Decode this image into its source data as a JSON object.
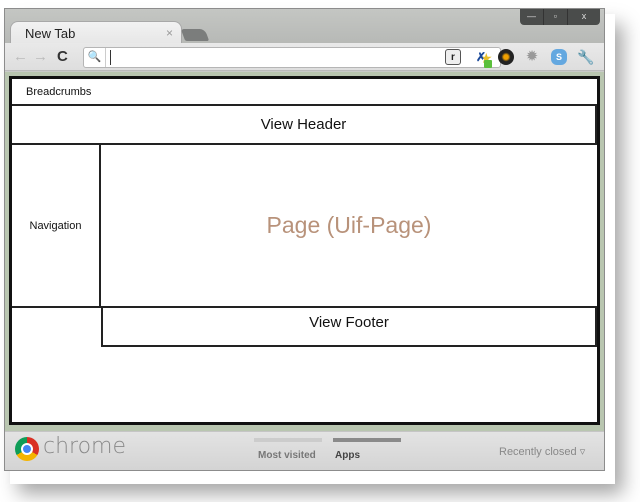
{
  "browser": {
    "tab": {
      "title": "New Tab",
      "close_glyph": "×"
    },
    "window_controls": {
      "minimize": "—",
      "maximize": "▫",
      "close": "x"
    },
    "toolbar": {
      "back_glyph": "←",
      "forward_glyph": "→",
      "reload_glyph": "C",
      "omnibox_value": "",
      "search_glyph": "🔍",
      "star_glyph": "★",
      "extensions": [
        {
          "name": "calendar-extension",
          "glyph": "r"
        },
        {
          "name": "person-extension",
          "glyph": "✗"
        },
        {
          "name": "color-wheel-extension",
          "glyph": ""
        },
        {
          "name": "gear-extension",
          "glyph": "✹"
        },
        {
          "name": "skype-extension",
          "glyph": "S"
        },
        {
          "name": "wrench-menu",
          "glyph": "🔧"
        }
      ]
    }
  },
  "layout": {
    "breadcrumbs": "Breadcrumbs",
    "view_header": "View Header",
    "navigation": "Navigation",
    "page": "Page (Uif-Page)",
    "view_footer": "View Footer"
  },
  "bottom_bar": {
    "brand": "chrome",
    "tabs": [
      {
        "label": "Most visited",
        "active": false
      },
      {
        "label": "Apps",
        "active": true
      }
    ],
    "recently_closed": "Recently closed ▿"
  },
  "colors": {
    "page_label": "#b8927a",
    "content_border": "#b9c6b0"
  }
}
